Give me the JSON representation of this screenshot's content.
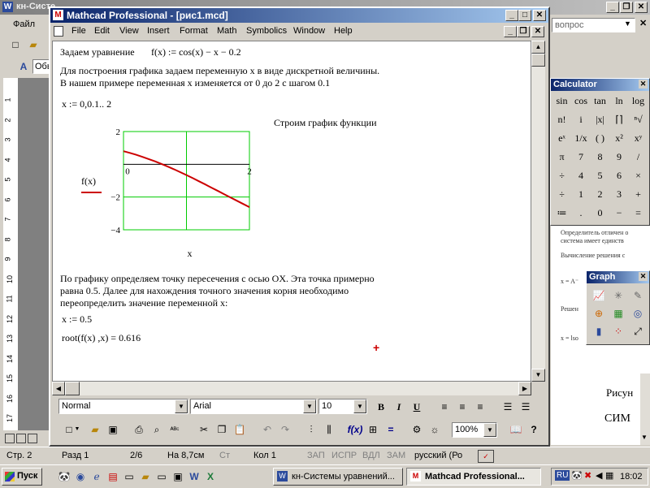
{
  "word": {
    "title": "кн-Систе",
    "menu_file": "Файл",
    "ask": "вопрос",
    "style_short": "Обы",
    "side_texts": [
      "Рисун",
      "СИМ"
    ],
    "status": {
      "page": "Стр. 2",
      "section": "Разд 1",
      "pages": "2/6",
      "at": "На 8,7см",
      "line": "Ст",
      "col": "Кол 1",
      "rec": "ЗАП",
      "trk": "ИСПР",
      "ext": "ВДЛ",
      "ovr": "ЗАМ",
      "lang": "русский (Ро"
    },
    "ruler_numbers": [
      "1",
      "2",
      "3",
      "4",
      "5",
      "6",
      "7",
      "8",
      "9",
      "10",
      "11",
      "12",
      "13",
      "14",
      "15",
      "16",
      "17"
    ]
  },
  "mathcad": {
    "title": "Mathcad Professional - [рис1.mcd]",
    "menu": [
      "File",
      "Edit",
      "View",
      "Insert",
      "Format",
      "Math",
      "Symbolics",
      "Window",
      "Help"
    ],
    "worksheet": {
      "line1_label": "Задаем уравнение",
      "line1_expr": "f(x) := cos(x) − x − 0.2",
      "para1_l1": "Для построения графика задаем переменную x в виде дискретной величины.",
      "para1_l2": "В нашем примере переменная x изменяется от  0  до  2  с  шагом   0.1",
      "range": "x := 0,0.1.. 2",
      "plot_caption": "Строим график функции",
      "para2_l1": "По графику определяем точку пересечения с осью OX.   Эта точка  примерно",
      "para2_l2": "равна  0.5.   Далее для  нахождения  точного значения корня  необходимо",
      "para2_l3": "переопределить значение переменной  x:",
      "reassign": "x := 0.5",
      "root": "root(f(x) ,x) = 0.616"
    },
    "format_bar": {
      "style": "Normal",
      "font": "Arial",
      "size": "10",
      "bold": "B",
      "italic": "I",
      "underline": "U"
    },
    "zoom": "100%",
    "colors": {
      "curve": "#cc0000",
      "grid": "#00cc00",
      "cursor": "#cc0000"
    }
  },
  "chart_data": {
    "type": "line",
    "series": [
      {
        "name": "f(x)",
        "x": [
          0,
          0.1,
          0.2,
          0.3,
          0.4,
          0.5,
          0.6,
          0.7,
          0.8,
          0.9,
          1.0,
          1.1,
          1.2,
          1.3,
          1.4,
          1.5,
          1.6,
          1.7,
          1.8,
          1.9,
          2.0
        ],
        "values": [
          0.8,
          0.695,
          0.58,
          0.455,
          0.321,
          0.178,
          0.025,
          -0.135,
          -0.303,
          -0.478,
          -0.66,
          -0.846,
          -1.038,
          -1.232,
          -1.43,
          -1.629,
          -1.829,
          -2.029,
          -2.227,
          -2.423,
          -2.616
        ]
      }
    ],
    "xlim": [
      0,
      2
    ],
    "ylim": [
      -4,
      2
    ],
    "x_ticks": [
      "0",
      "2"
    ],
    "y_ticks": [
      "2",
      "−2",
      "−4"
    ],
    "xlabel": "x",
    "ylabel": "f(x)",
    "grid": true
  },
  "calculator": {
    "title": "Calculator",
    "rows": [
      [
        "sin",
        "cos",
        "tan",
        "ln",
        "log"
      ],
      [
        "n!",
        "i",
        "|x|",
        "⌈⌉",
        "ⁿ√"
      ],
      [
        "eˣ",
        "1/x",
        "( )",
        "x²",
        "xʸ"
      ],
      [
        "π",
        "7",
        "8",
        "9",
        "/"
      ],
      [
        "÷",
        "4",
        "5",
        "6",
        "×"
      ],
      [
        "÷",
        "1",
        "2",
        "3",
        "+"
      ],
      [
        "≔",
        ".",
        "0",
        "−",
        "="
      ]
    ]
  },
  "graph_palette": {
    "title": "Graph"
  },
  "bg_doc_snippets": [
    "Определитель отличен о",
    "система имеет единств",
    "Вычисление решения с",
    "x = A⁻",
    "Решен",
    "x = lso"
  ],
  "taskbar": {
    "start": "Пуск",
    "buttons": [
      "кн-Системы уравнений...",
      "Mathcad Professional..."
    ],
    "lang": "RU",
    "clock": "18:02"
  }
}
